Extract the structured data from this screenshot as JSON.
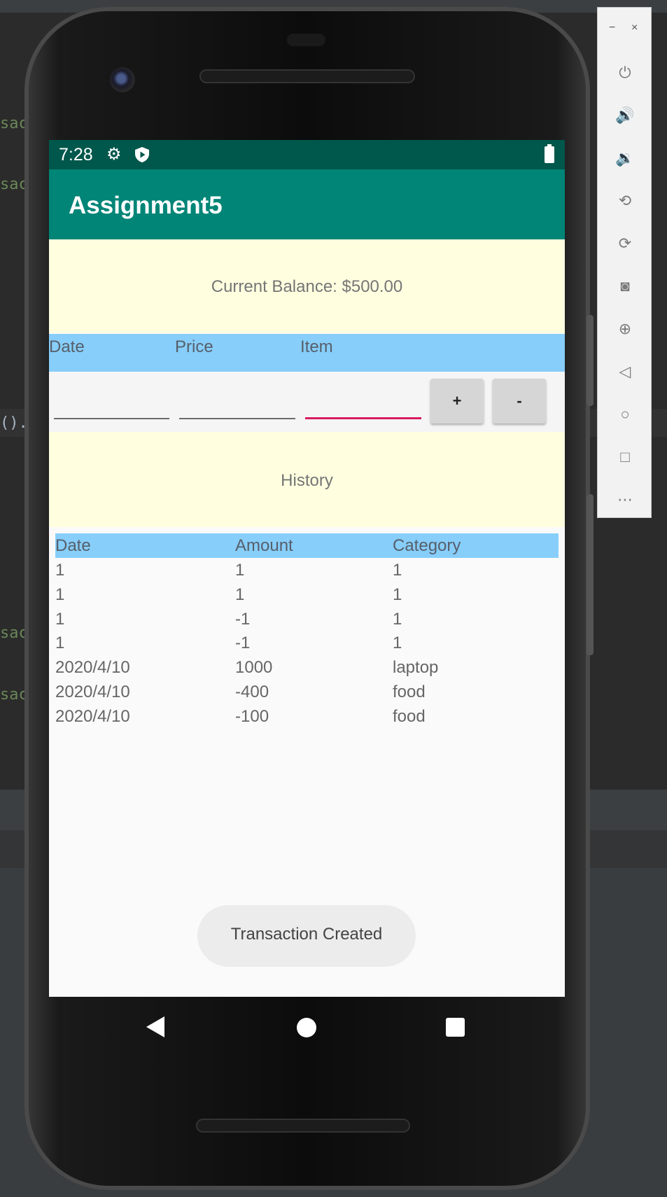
{
  "ide": {
    "code_fragments": [
      "sac",
      "sac",
      "().",
      "sac",
      "sac"
    ]
  },
  "status_bar": {
    "time": "7:28"
  },
  "app_bar": {
    "title": "Assignment5"
  },
  "balance": {
    "text": "Current Balance: $500.00"
  },
  "entry": {
    "headers": [
      "Date",
      "Price",
      "Item"
    ],
    "fields": [
      {
        "value": "",
        "placeholder": ""
      },
      {
        "value": "",
        "placeholder": ""
      },
      {
        "value": "",
        "placeholder": ""
      }
    ],
    "plus_label": "+",
    "minus_label": "-"
  },
  "history": {
    "title": "History",
    "columns": [
      "Date",
      "Amount",
      "Category"
    ],
    "rows": [
      [
        "1",
        "1",
        "1"
      ],
      [
        "1",
        "1",
        "1"
      ],
      [
        "1",
        "-1",
        "1"
      ],
      [
        "1",
        "-1",
        "1"
      ],
      [
        "2020/4/10",
        "1000",
        "laptop"
      ],
      [
        "2020/4/10",
        "-400",
        "food"
      ],
      [
        "2020/4/10",
        "-100",
        "food"
      ]
    ]
  },
  "toast": {
    "text": "Transaction Created"
  },
  "emulator_toolbar": {
    "minimize_label": "−",
    "close_label": "×",
    "icons": [
      "power-icon",
      "volume-up-icon",
      "volume-down-icon",
      "rotate-left-icon",
      "rotate-right-icon",
      "screenshot-icon",
      "zoom-icon",
      "back-icon",
      "home-icon",
      "overview-icon",
      "more-icon"
    ]
  },
  "colors": {
    "app_bar": "#008577",
    "status_bar": "#00574b",
    "panel_yellow": "#ffffe0",
    "header_blue": "#87cefa",
    "accent": "#d81b60"
  }
}
